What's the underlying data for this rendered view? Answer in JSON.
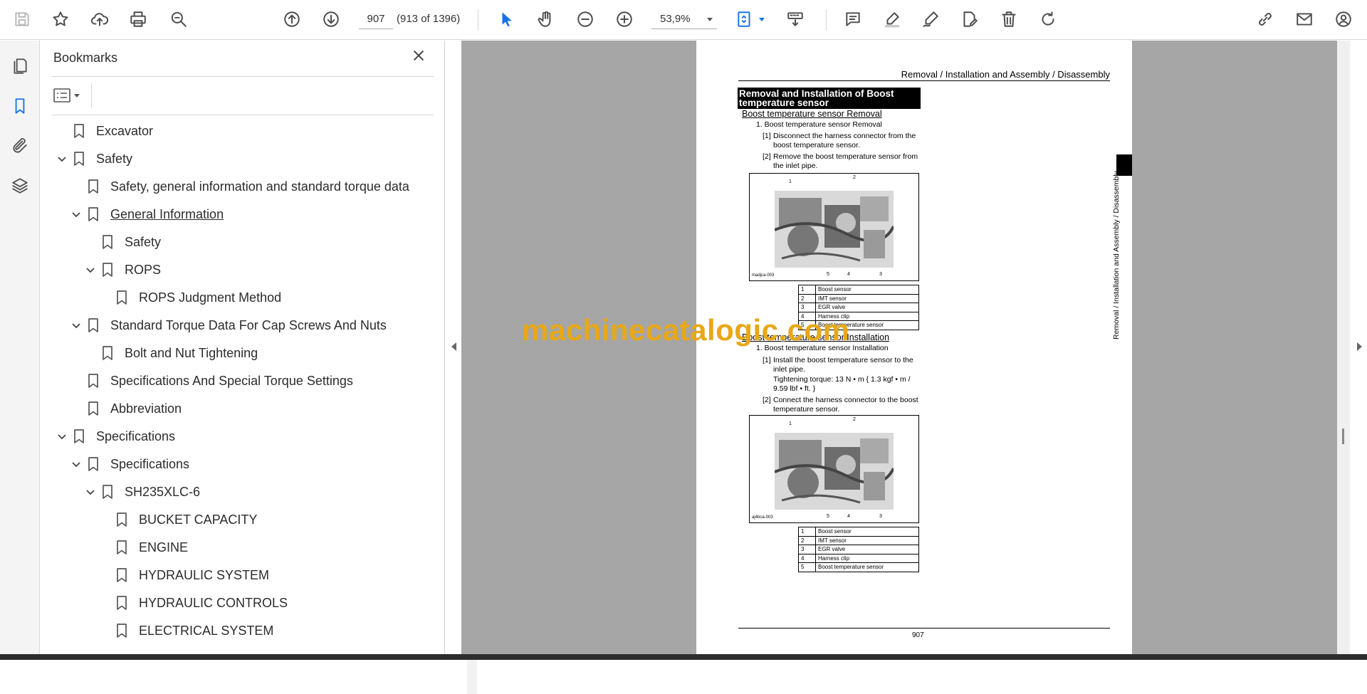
{
  "toolbar": {
    "page_number": "907",
    "page_count": "(913 of 1396)",
    "zoom": "53,9%"
  },
  "bookmarks_panel": {
    "title": "Bookmarks",
    "items": [
      {
        "label": "Excavator",
        "level": 0,
        "expanded": null,
        "underline": false
      },
      {
        "label": "Safety",
        "level": 0,
        "expanded": true,
        "underline": false
      },
      {
        "label": "Safety, general information and standard torque data",
        "level": 1,
        "expanded": null,
        "underline": false
      },
      {
        "label": "General Information",
        "level": 1,
        "expanded": true,
        "underline": true
      },
      {
        "label": "Safety",
        "level": 2,
        "expanded": null,
        "underline": false
      },
      {
        "label": "ROPS",
        "level": 2,
        "expanded": true,
        "underline": false
      },
      {
        "label": "ROPS Judgment Method",
        "level": 3,
        "expanded": null,
        "underline": false
      },
      {
        "label": "Standard Torque Data For Cap Screws And Nuts",
        "level": 1,
        "expanded": true,
        "underline": false
      },
      {
        "label": "Bolt and Nut Tightening",
        "level": 2,
        "expanded": null,
        "underline": false
      },
      {
        "label": "Specifications And Special Torque Settings",
        "level": 1,
        "expanded": null,
        "underline": false
      },
      {
        "label": "Abbreviation",
        "level": 1,
        "expanded": null,
        "underline": false
      },
      {
        "label": "Specifications",
        "level": 0,
        "expanded": true,
        "underline": false
      },
      {
        "label": "Specifications",
        "level": 1,
        "expanded": true,
        "underline": false
      },
      {
        "label": "SH235XLC-6",
        "level": 2,
        "expanded": true,
        "underline": false
      },
      {
        "label": "BUCKET CAPACITY",
        "level": 3,
        "expanded": null,
        "underline": false
      },
      {
        "label": "ENGINE",
        "level": 3,
        "expanded": null,
        "underline": false
      },
      {
        "label": "HYDRAULIC SYSTEM",
        "level": 3,
        "expanded": null,
        "underline": false
      },
      {
        "label": "HYDRAULIC CONTROLS",
        "level": 3,
        "expanded": null,
        "underline": false
      },
      {
        "label": "ELECTRICAL SYSTEM",
        "level": 3,
        "expanded": null,
        "underline": false
      }
    ]
  },
  "document": {
    "header": "Removal / Installation and Assembly / Disassembly",
    "section_title": "Removal and Installation of Boost temperature sensor",
    "removal": {
      "heading": "Boost temperature sensor Removal",
      "step": "1. Boost temperature sensor Removal",
      "sub1_num": "[1]",
      "sub1": "Disconnect the harness connector from the boost temperature sensor.",
      "sub2_num": "[2]",
      "sub2": "Remove the boost temperature sensor from the inlet pipe.",
      "figure_id": "madjca-003"
    },
    "installation": {
      "heading": "Boost temperature sensor Installation",
      "step": "1. Boost temperature sensor Installation",
      "sub1_num": "[1]",
      "sub1": "Install the boost temperature sensor to the inlet pipe.",
      "torque": "Tightening torque: 13 N • m { 1.3 kgf • m / 9.59 lbf • ft. }",
      "sub2_num": "[2]",
      "sub2": "Connect the harness connector to the boost temperature sensor.",
      "figure_id": "aj4bca-003"
    },
    "callouts": [
      "1",
      "2",
      "3",
      "4",
      "5"
    ],
    "legend": [
      {
        "n": "1",
        "label": "Boost sensor"
      },
      {
        "n": "2",
        "label": "IMT sensor"
      },
      {
        "n": "3",
        "label": "EGR valve"
      },
      {
        "n": "4",
        "label": "Harness clip"
      },
      {
        "n": "5",
        "label": "Boost temperature sensor"
      }
    ],
    "side_tab": "Removal / Installation and Assembly / Disassembly",
    "page_number": "907"
  },
  "watermark": "machinecatalogic.com",
  "colors": {
    "accent": "#1473e6",
    "watermark": "#e8a817",
    "viewer_bg": "#a6a6a6"
  }
}
